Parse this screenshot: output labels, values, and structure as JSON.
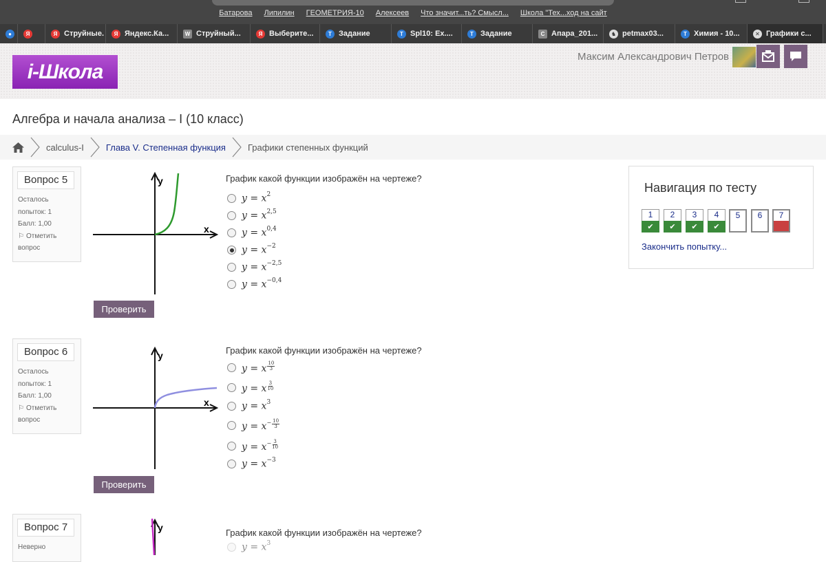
{
  "bookmarks": [
    "Батарова",
    "Липилин",
    "ГЕОМЕТРИЯ-10",
    "Алексеев",
    "Что значит...ть? Смысл...",
    "Школа \"Тех...ход на сайт"
  ],
  "tabs": [
    {
      "label": "",
      "icon": "blue-circle",
      "color": "#2e7cd6"
    },
    {
      "label": "",
      "icon": "yandex-icon",
      "color": "#e53935"
    },
    {
      "label": "Струйные.",
      "icon": "yandex-icon",
      "color": "#e53935"
    },
    {
      "label": "Яндекс.Ка...",
      "icon": "yandex-icon",
      "color": "#e53935"
    },
    {
      "label": "Струйный...",
      "icon": "wikipedia-icon",
      "color": "#888888"
    },
    {
      "label": "Выберите...",
      "icon": "yandex-icon",
      "color": "#e53935"
    },
    {
      "label": "Задание",
      "icon": "t-icon",
      "color": "#2e7cd6"
    },
    {
      "label": "Spl10: Ex....",
      "icon": "t-icon",
      "color": "#2e7cd6"
    },
    {
      "label": "Задание",
      "icon": "t-icon",
      "color": "#2e7cd6"
    },
    {
      "label": "Апара_201...",
      "icon": "c-icon",
      "color": "#888888"
    },
    {
      "label": "petmax03...",
      "icon": "chess-icon",
      "color": "#dddddd"
    },
    {
      "label": "Химия - 10...",
      "icon": "t-icon",
      "color": "#2e7cd6"
    },
    {
      "label": "Графики с...",
      "icon": "close-icon",
      "color": "#dddddd"
    }
  ],
  "header": {
    "logo_text": "i-Школа",
    "user_name": "Максим Александрович Петров"
  },
  "course_title": "Алгебра и начала анализа – I (10 класс)",
  "breadcrumb": {
    "course": "calculus-I",
    "chapter": "Глава V. Степенная функция",
    "topic": "Графики степенных функций"
  },
  "questions": [
    {
      "number": "Вопрос 5",
      "attempts_label": "Осталось",
      "attempts_value": "попыток: 1",
      "score": "Балл: 1,00",
      "flag_label": "Отметить",
      "flag_label2": "вопрос",
      "text": "График какой функции изображён на чертеже?",
      "axis_x": "x",
      "axis_y": "y",
      "curve_color": "#2e9a2e",
      "options": [
        {
          "base": "y = x",
          "exp": "2",
          "checked": false
        },
        {
          "base": "y = x",
          "exp": "2,5",
          "checked": false
        },
        {
          "base": "y = x",
          "exp": "0,4",
          "checked": false
        },
        {
          "base": "y = x",
          "exp": "−2",
          "checked": true
        },
        {
          "base": "y = x",
          "exp": "−2,5",
          "checked": false
        },
        {
          "base": "y = x",
          "exp": "−0,4",
          "checked": false
        }
      ],
      "check_label": "Проверить"
    },
    {
      "number": "Вопрос 6",
      "attempts_label": "Осталось",
      "attempts_value": "попыток: 1",
      "score": "Балл: 1,00",
      "flag_label": "Отметить",
      "flag_label2": "вопрос",
      "text": "График какой функции изображён на чертеже?",
      "axis_x": "x",
      "axis_y": "y",
      "curve_color": "#8f8fe0",
      "options": [
        {
          "base": "y = x",
          "num": "10",
          "den": "3",
          "neg": false
        },
        {
          "base": "y = x",
          "num": "3",
          "den": "10",
          "neg": false
        },
        {
          "base": "y = x",
          "exp": "3"
        },
        {
          "base": "y = x",
          "num": "10",
          "den": "3",
          "neg": true
        },
        {
          "base": "y = x",
          "num": "3",
          "den": "10",
          "neg": true
        },
        {
          "base": "y = x",
          "exp": "−3"
        }
      ],
      "check_label": "Проверить"
    },
    {
      "number": "Вопрос 7",
      "status": "Неверно",
      "text": "График какой функции изображён на чертеже?",
      "axis_y": "y",
      "curve_color": "#c42ac4",
      "options": [
        {
          "base": "y = x",
          "exp": "3"
        }
      ]
    }
  ],
  "nav": {
    "title": "Навигация по тесту",
    "buttons": [
      {
        "label": "1",
        "status": "correct"
      },
      {
        "label": "2",
        "status": "correct"
      },
      {
        "label": "3",
        "status": "correct"
      },
      {
        "label": "4",
        "status": "correct"
      },
      {
        "label": "5",
        "status": "unanswered"
      },
      {
        "label": "6",
        "status": "unanswered"
      },
      {
        "label": "7",
        "status": "incorrect"
      }
    ],
    "finish_link": "Закончить попытку...",
    "colors": {
      "correct": "#3a8a3a",
      "incorrect": "#c94040"
    }
  }
}
